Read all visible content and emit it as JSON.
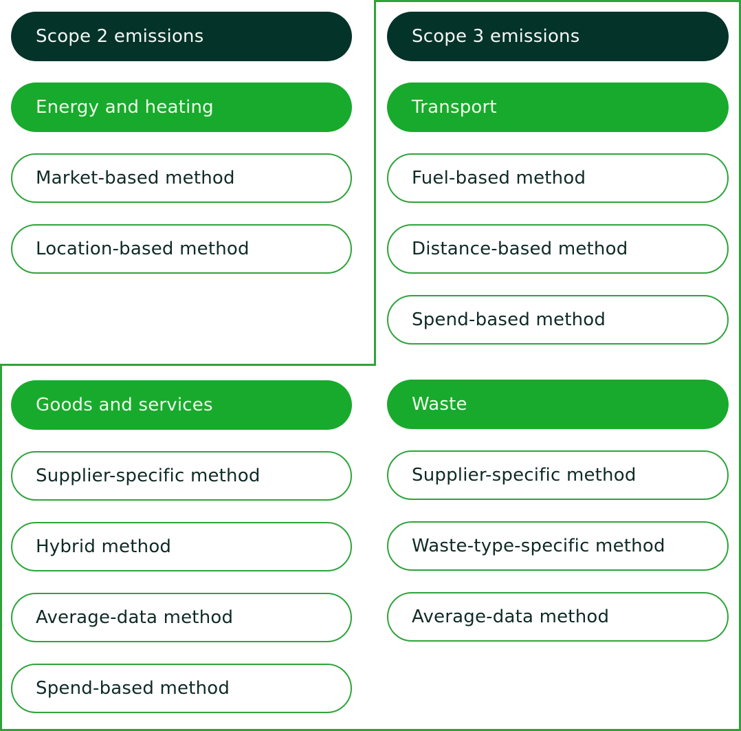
{
  "colors": {
    "scope_header": "#04332a",
    "category": "#18aa2c",
    "method_border": "#2ea33a",
    "method_text": "#0f2a26"
  },
  "groups": [
    {
      "scope": "Scope 2 emissions",
      "categories": [
        {
          "name": "Energy and heating",
          "methods": [
            "Market-based method",
            "Location-based method"
          ]
        }
      ]
    },
    {
      "scope": "Scope 3 emissions",
      "categories": [
        {
          "name": "Transport",
          "methods": [
            "Fuel-based method",
            "Distance-based method",
            "Spend-based method"
          ]
        },
        {
          "name": "Goods and services",
          "methods": [
            "Supplier-specific method",
            "Hybrid method",
            "Average-data method",
            "Spend-based method"
          ]
        },
        {
          "name": "Waste",
          "methods": [
            "Supplier-specific method",
            "Waste-type-specific method",
            "Average-data method"
          ]
        }
      ]
    }
  ]
}
